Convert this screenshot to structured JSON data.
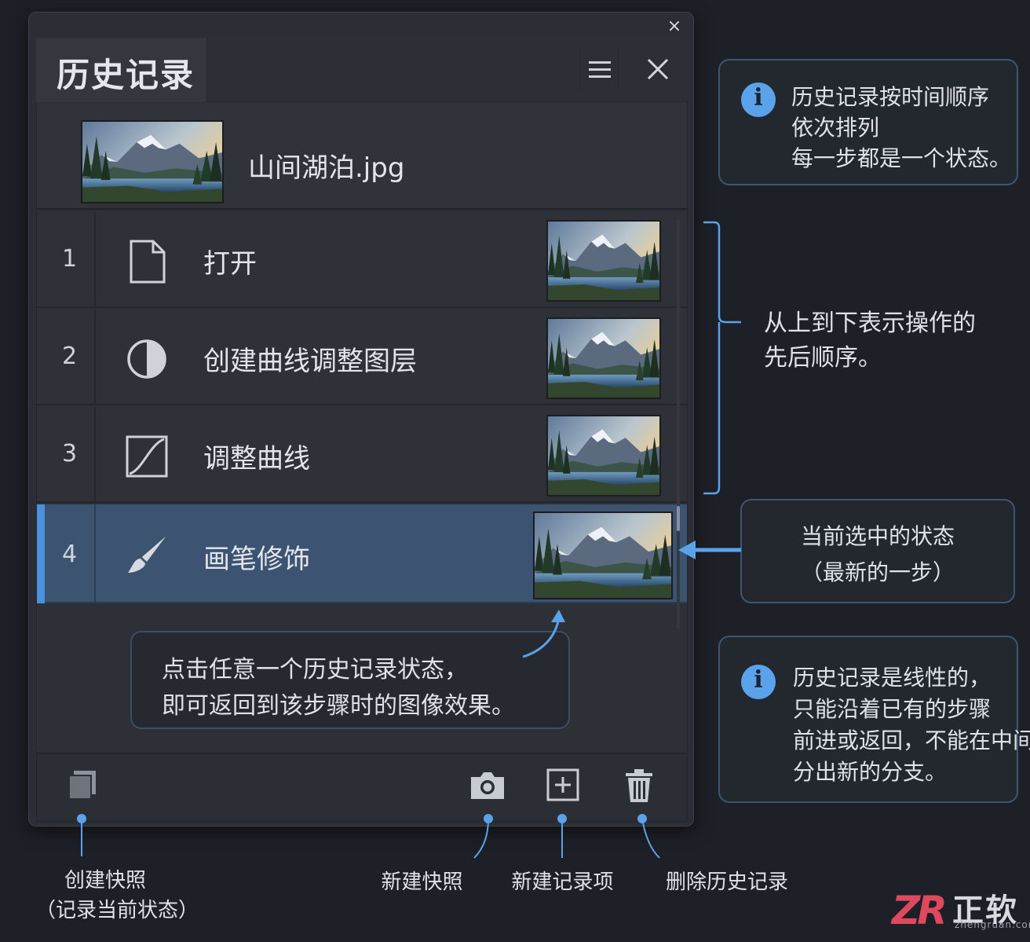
{
  "window": {
    "close_glyph": "×"
  },
  "panel": {
    "title": "历史记录",
    "menu_icon": "hamburger-menu-icon",
    "close_icon": "close-icon"
  },
  "document": {
    "name": "山间湖泊.jpg"
  },
  "history": [
    {
      "index": "1",
      "label": "打开",
      "icon": "document-icon",
      "selected": false
    },
    {
      "index": "2",
      "label": "创建曲线调整图层",
      "icon": "half-circle-contrast-icon",
      "selected": false
    },
    {
      "index": "3",
      "label": "调整曲线",
      "icon": "curves-icon",
      "selected": false
    },
    {
      "index": "4",
      "label": "画笔修饰",
      "icon": "brush-icon",
      "selected": true
    }
  ],
  "tooltip_click": {
    "line1": "点击任意一个历史记录状态，",
    "line2": "即可返回到该步骤时的图像效果。"
  },
  "footer": {
    "buttons": [
      {
        "icon": "copy-snapshot-icon",
        "label_line1": "创建快照",
        "label_line2": "（记录当前状态）"
      },
      {
        "icon": "camera-icon",
        "label_line1": "新建快照"
      },
      {
        "icon": "add-square-icon",
        "label_line1": "新建记录项"
      },
      {
        "icon": "trash-icon",
        "label_line1": "删除历史记录"
      }
    ]
  },
  "callouts": {
    "order": {
      "line1": "历史记录按时间顺序",
      "line2": "依次排列",
      "line3": "每一步都是一个状态。"
    },
    "sequence": {
      "line1": "从上到下表示操作的",
      "line2": "先后顺序。"
    },
    "current": {
      "line1": "当前选中的状态",
      "line2": "（最新的一步）"
    },
    "linear": {
      "line1": "历史记录是线性的，",
      "line2": "只能沿着已有的步骤",
      "line3": "前进或返回，不能在中间",
      "line4": "分出新的分支。"
    }
  },
  "colors": {
    "background": "#1d2026",
    "panel": "#2d3036",
    "selected_row": "#3c5472",
    "accent": "#4a92e0",
    "info_icon": "#5aa3ea",
    "watermark_red": "#e0485e"
  },
  "watermark": {
    "logo": "ZR",
    "text": "正软",
    "url": "zhengruan.com"
  }
}
